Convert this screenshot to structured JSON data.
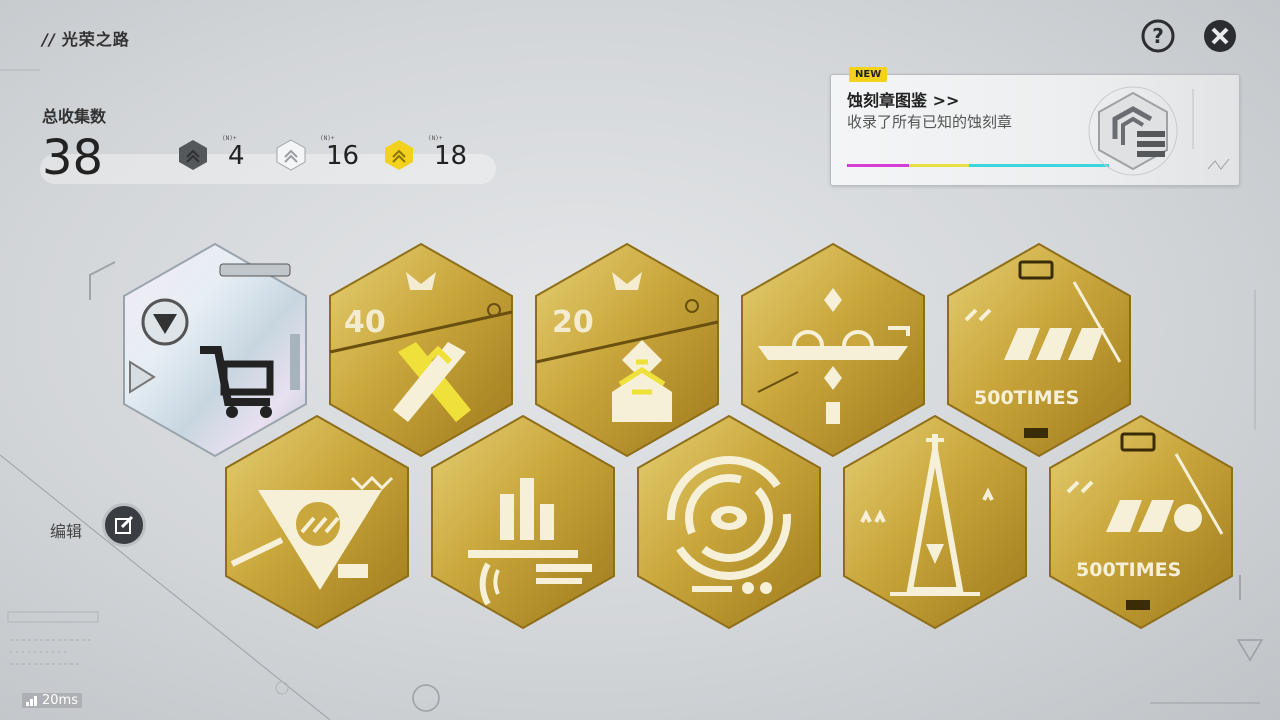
{
  "header": {
    "title": "光荣之路",
    "title_prefix": "//"
  },
  "collection": {
    "label": "总收集数",
    "total": "38",
    "tiers": [
      {
        "name": "dark-tier",
        "count": "4",
        "color": "#5a5d60",
        "tag": "(N)+"
      },
      {
        "name": "silver-tier",
        "count": "16",
        "color": "#eef0f2",
        "tag": "(N)+"
      },
      {
        "name": "gold-tier",
        "count": "18",
        "color": "#f2d21c",
        "tag": "(N)+"
      }
    ]
  },
  "top_buttons": {
    "help_icon": "question-icon",
    "close_icon": "close-icon"
  },
  "codex_card": {
    "badge": "NEW",
    "title": "蚀刻章图鉴 >>",
    "subtitle": "收录了所有已知的蚀刻章",
    "stripe_colors": [
      "#d63cd6",
      "#e8e040",
      "#3ad6e0"
    ]
  },
  "edit": {
    "label": "编辑",
    "icon": "edit-icon"
  },
  "status": {
    "ping": "20ms"
  },
  "medals": [
    {
      "id": "medal-1",
      "variant": "holo",
      "text": "",
      "icon": "shopping-cart-icon"
    },
    {
      "id": "medal-2",
      "variant": "gold",
      "text": "40",
      "icon": "crossed-swords-icon"
    },
    {
      "id": "medal-3",
      "variant": "gold",
      "text": "20",
      "icon": "tower-icon"
    },
    {
      "id": "medal-4",
      "variant": "gold",
      "text": "",
      "icon": "arena-icon"
    },
    {
      "id": "medal-5",
      "variant": "gold",
      "text": "500TIMES",
      "icon": "chain-icon"
    },
    {
      "id": "medal-6",
      "variant": "gold",
      "text": "",
      "icon": "triangle-arrow-icon"
    },
    {
      "id": "medal-7",
      "variant": "gold",
      "text": "",
      "icon": "bar-chart-icon"
    },
    {
      "id": "medal-8",
      "variant": "gold",
      "text": "",
      "icon": "target-icon"
    },
    {
      "id": "medal-9",
      "variant": "gold",
      "text": "",
      "icon": "spire-icon"
    },
    {
      "id": "medal-10",
      "variant": "gold",
      "text": "500TIMES",
      "icon": "chain-icon"
    }
  ]
}
